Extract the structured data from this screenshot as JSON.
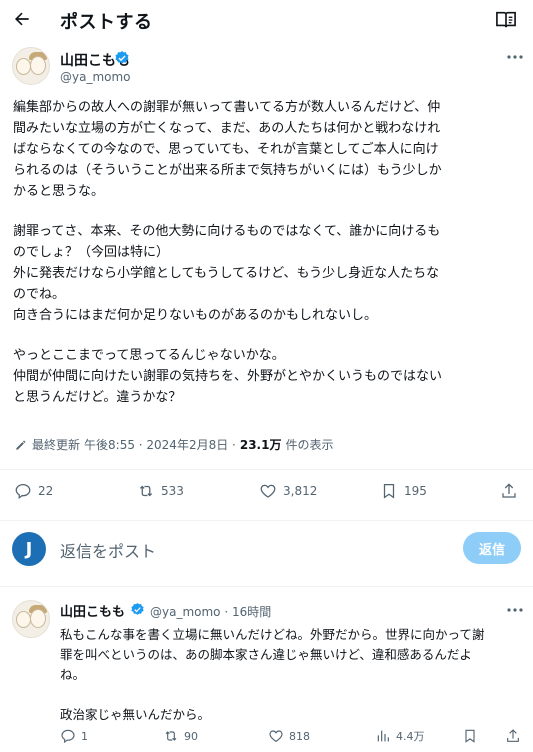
{
  "header": {
    "title": "ポストする"
  },
  "post": {
    "author_name": "山田こもも",
    "author_handle": "@ya_momo",
    "paragraphs": [
      "編集部からの故人への謝罪が無いって書いてる方が数人いるんだけど、仲\n間みたいな立場の方が亡くなって、まだ、あの人たちは何かと戦わなけれ\nばならなくての今なので、思っていても、それが言葉としてご本人に向け\nられるのは（そういうことが出来る所まで気持ちがいくには）もう少しか\nかると思うな。",
      "謝罪ってさ、本来、その他大勢に向けるものではなくて、誰かに向けるも\nのでしょ？（今回は特に）\n外に発表だけなら小学館としてもうしてるけど、もう少し身近な人たちな\nのでね。\n向き合うにはまだ何か足りないものがあるのかもしれないし。",
      "やっとここまでって思ってるんじゃないかな。\n仲間が仲間に向けたい謝罪の気持ちを、外野がとやかくいうものではない\nと思うんだけど。違うかな？"
    ],
    "meta": {
      "updated_label": "最終更新",
      "timestamp": "午後8:55 · 2024年2月8日 ·",
      "views": "23.1万",
      "views_suffix": "件の表示"
    },
    "actions": {
      "replies": "22",
      "reposts": "533",
      "likes": "3,812",
      "bookmarks": "195"
    }
  },
  "reply_bar": {
    "avatar_letter": "J",
    "placeholder": "返信をポスト",
    "button_label": "返信"
  },
  "reply": {
    "author_name": "山田こもも",
    "meta": "@ya_momo · 16時間",
    "paragraphs": [
      "私もこんな事を書く立場に無いんだけどね。外野だから。世界に向かって謝\n罪を叫べというのは、あの脚本家さん違じゃ無いけど、違和感あるんだよ\nね。",
      "政治家じゃ無いんだから。"
    ],
    "actions": {
      "replies": "1",
      "reposts": "90",
      "likes": "818",
      "views": "4.4万"
    }
  },
  "colors": {
    "accent": "#1d9bf0",
    "muted": "#536471",
    "reply_button": "#8ecdf7"
  }
}
